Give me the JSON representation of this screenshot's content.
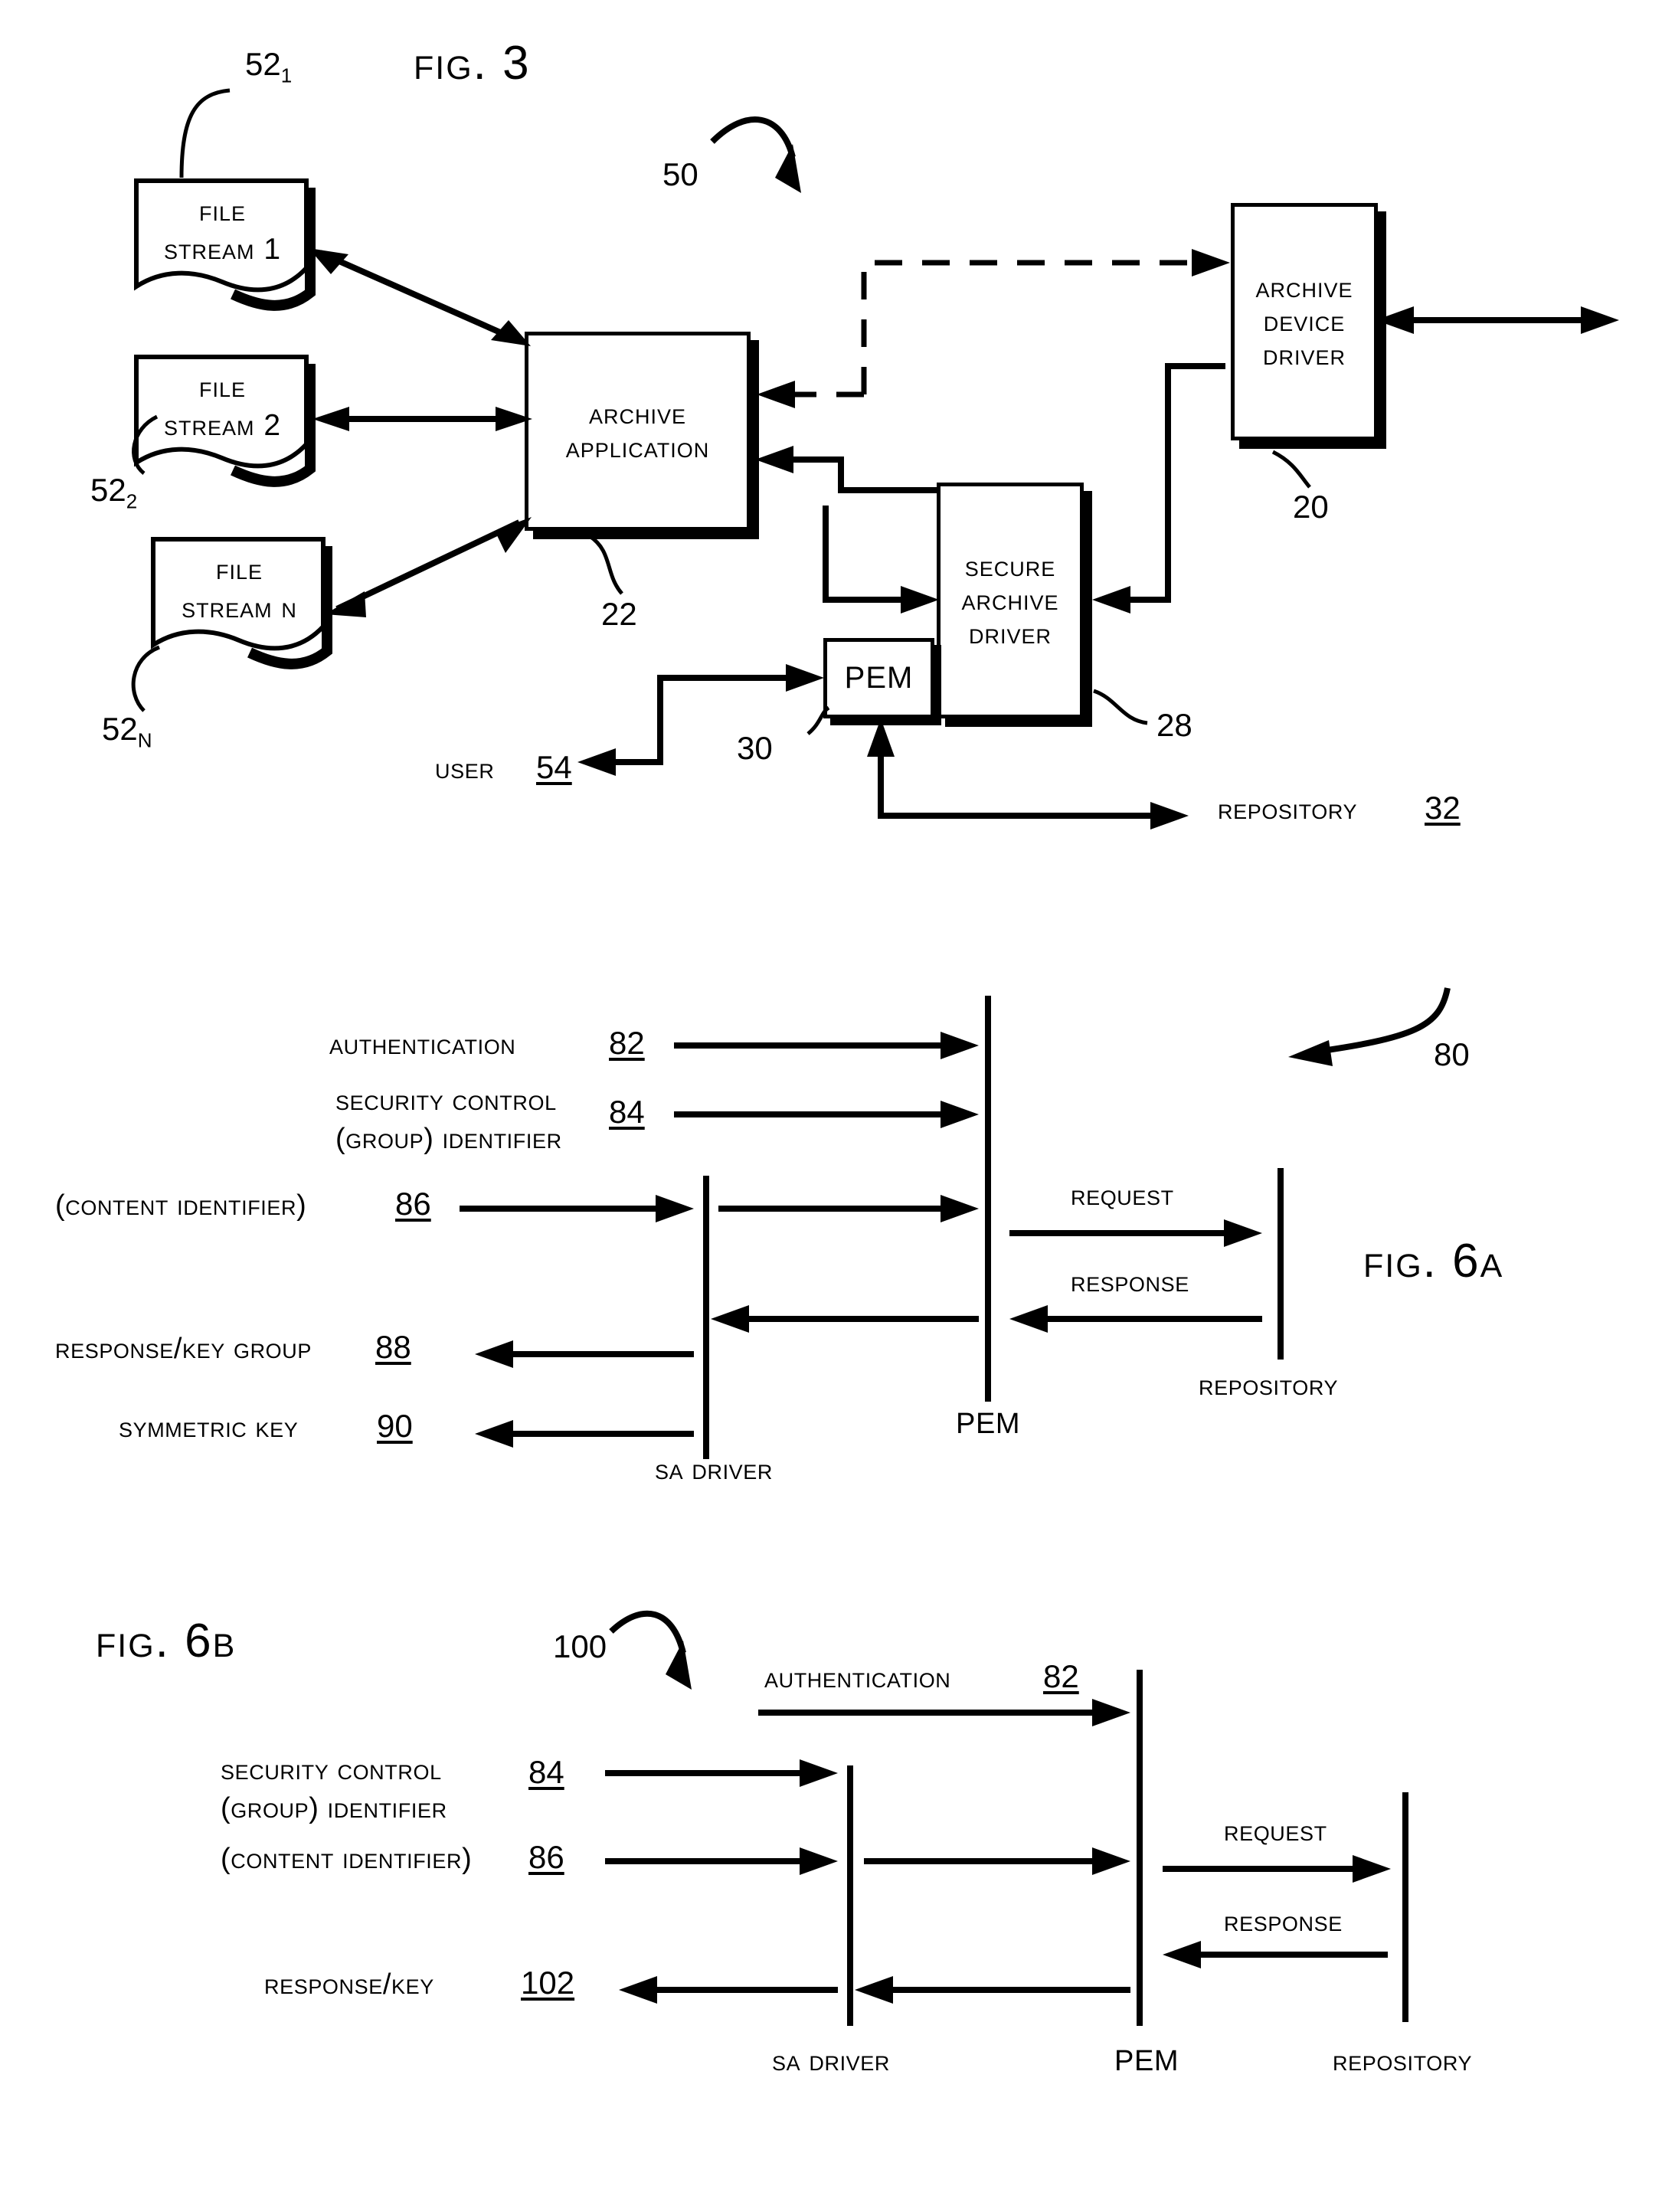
{
  "figures": [
    {
      "id": "fig3",
      "title": "Fig. 3",
      "system_ref": "50",
      "boxes": [
        {
          "name": "file-stream-1",
          "lines": [
            "File",
            "Stream 1"
          ],
          "ref": "52",
          "sub": "1"
        },
        {
          "name": "file-stream-2",
          "lines": [
            "File",
            "Stream 2"
          ],
          "ref": "52",
          "sub": "2"
        },
        {
          "name": "file-stream-n",
          "lines": [
            "File",
            "Stream N"
          ],
          "ref": "52",
          "sub": "N"
        },
        {
          "name": "archive-application",
          "lines": [
            "Archive",
            "Application"
          ],
          "ref": "22",
          "sub": ""
        },
        {
          "name": "archive-device-driver",
          "lines": [
            "Archive",
            "Device",
            "Driver"
          ],
          "ref": "20",
          "sub": ""
        },
        {
          "name": "secure-archive-driver",
          "lines": [
            "Secure",
            "Archive",
            "Driver"
          ],
          "ref": "28",
          "sub": ""
        },
        {
          "name": "pem",
          "lines": [
            "PEM"
          ],
          "ref": "30",
          "sub": ""
        }
      ],
      "endpoints": [
        {
          "name": "user",
          "label": "User",
          "ref": "54"
        },
        {
          "name": "repository",
          "label": "Repository",
          "ref": "32"
        }
      ]
    },
    {
      "id": "fig6a",
      "title": "Fig. 6A",
      "system_ref": "80",
      "messages": [
        {
          "name": "authentication",
          "label": "Authentication",
          "ref": "82"
        },
        {
          "name": "security-control-group-identifier",
          "label": "Security Control\n(Group) Identifier",
          "label_line1": "Security Control",
          "label_line2": "(Group) Identifier",
          "ref": "84"
        },
        {
          "name": "content-identifier",
          "label": "(Content Identifier)",
          "ref": "86"
        },
        {
          "name": "response-key-group",
          "label": "Response/Key Group",
          "ref": "88"
        },
        {
          "name": "symmetric-key",
          "label": "Symmetric Key",
          "ref": "90"
        }
      ],
      "lifelines": [
        {
          "name": "sa-driver",
          "label": "SA Driver"
        },
        {
          "name": "pem",
          "label": "PEM"
        },
        {
          "name": "repository",
          "label": "Repository"
        }
      ],
      "exchange": [
        {
          "name": "request",
          "label": "Request"
        },
        {
          "name": "response",
          "label": "Response"
        }
      ]
    },
    {
      "id": "fig6b",
      "title": "Fig. 6B",
      "system_ref": "100",
      "messages": [
        {
          "name": "authentication",
          "label": "Authentication",
          "ref": "82"
        },
        {
          "name": "security-control-group-identifier",
          "label_line1": "Security Control",
          "label_line2": "(Group) Identifier",
          "ref": "84"
        },
        {
          "name": "content-identifier",
          "label": "(Content Identifier)",
          "ref": "86"
        },
        {
          "name": "response-key",
          "label": "Response/Key",
          "ref": "102"
        }
      ],
      "lifelines": [
        {
          "name": "sa-driver",
          "label": "SA Driver"
        },
        {
          "name": "pem",
          "label": "PEM"
        },
        {
          "name": "repository",
          "label": "Repository"
        }
      ],
      "exchange": [
        {
          "name": "request",
          "label": "Request"
        },
        {
          "name": "response",
          "label": "Response"
        }
      ]
    }
  ],
  "colors": {
    "ink": "#000000",
    "paper": "#ffffff"
  }
}
